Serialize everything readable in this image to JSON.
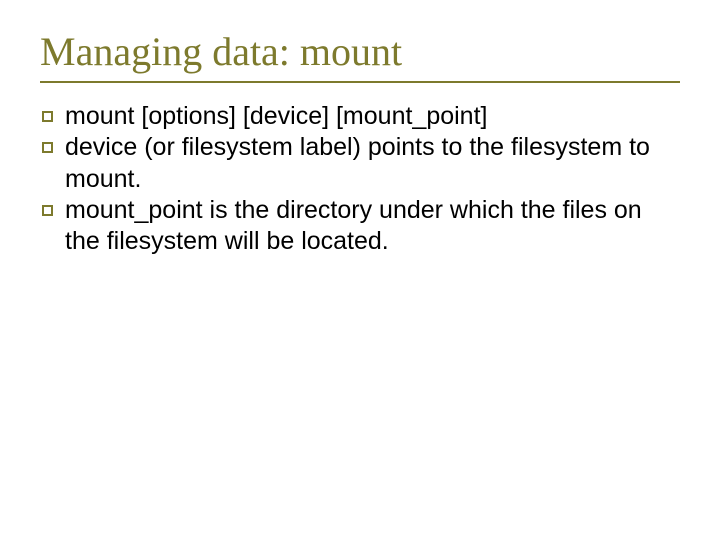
{
  "title": "Managing data: mount",
  "bullets": [
    "mount [options] [device] [mount_point]",
    "device (or filesystem label) points to the filesystem to mount.",
    "mount_point is the directory under which the files on the filesystem will be located."
  ],
  "colors": {
    "accent": "#7d7a2d",
    "text": "#000000",
    "background": "#ffffff"
  }
}
